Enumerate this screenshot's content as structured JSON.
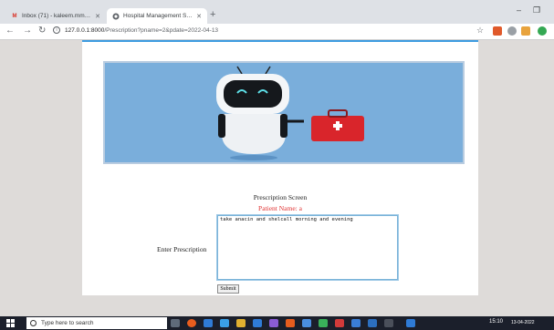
{
  "tabs": [
    {
      "title": "Inbox (71) - kaleem.mmd@gmai",
      "icon": "gmail-icon"
    },
    {
      "title": "Hospital Management System w",
      "icon": "globe-icon"
    }
  ],
  "browser": {
    "url_host": "127.0.0.1:8000",
    "url_path": "/Prescription?pname=2&pdate=2022-04-13"
  },
  "form": {
    "screen_title": "Prescription Screen",
    "patient_name": "Patient Name: a",
    "label": "Enter Prescription",
    "prescription_value": "take anacin and shelcall morning and evening",
    "submit_label": "Submit"
  },
  "taskbar": {
    "search_placeholder": "Type here to search",
    "time": "15:10",
    "date": "13-04-2022"
  },
  "colors": {
    "accent_blue": "#3c9be0",
    "banner_bg": "#7aaedb",
    "patient_red": "#e03131"
  }
}
